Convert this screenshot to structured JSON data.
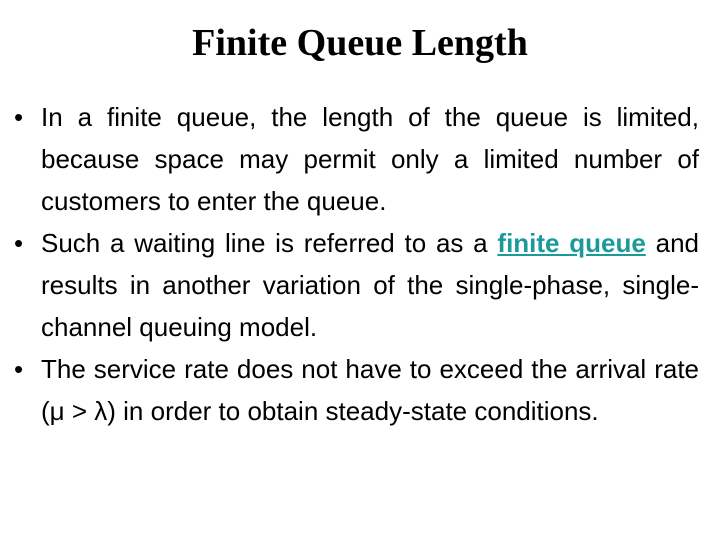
{
  "slide": {
    "title": "Finite Queue Length",
    "bullets": [
      {
        "text": "In a finite queue, the length of the queue is limited, because space may permit only a limited number of customers to enter the queue."
      },
      {
        "before": "Such a waiting line is referred to as a ",
        "link": "finite queue",
        "after": " and results in another variation of the single-phase, single-channel queuing model."
      },
      {
        "text": "The service rate does not have to exceed the arrival rate (μ > λ) in order to obtain steady-state conditions."
      }
    ],
    "bullet_glyph": "•",
    "colors": {
      "text": "#000000",
      "link": "#1a9a9a",
      "background": "#ffffff"
    }
  }
}
